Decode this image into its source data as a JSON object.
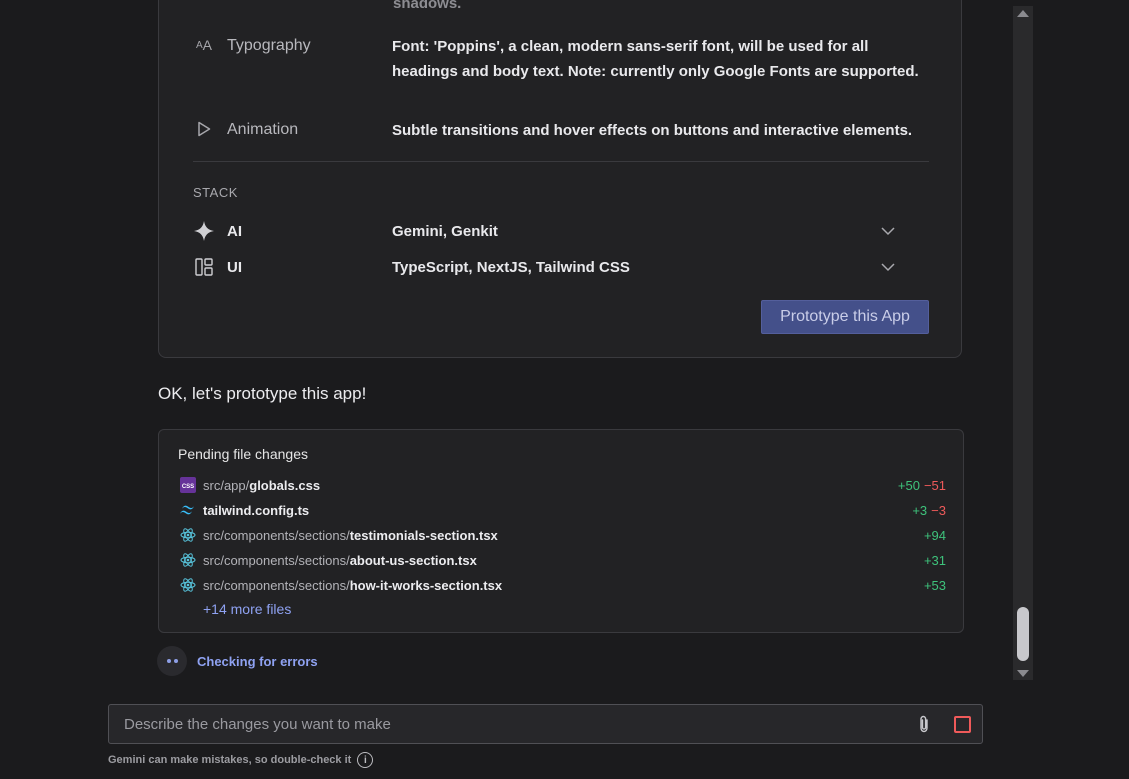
{
  "blueprint": {
    "clipped_text": "shadows.",
    "typography": {
      "label": "Typography",
      "value": "Font: 'Poppins', a clean, modern sans-serif font, will be used for all headings and body text. Note: currently only Google Fonts are supported."
    },
    "animation": {
      "label": "Animation",
      "value": "Subtle transitions and hover effects on buttons and interactive elements."
    },
    "stack_heading": "STACK",
    "stack": [
      {
        "label": "AI",
        "value": "Gemini, Genkit",
        "icon": "sparkle-icon"
      },
      {
        "label": "UI",
        "value": "TypeScript, NextJS, Tailwind CSS",
        "icon": "layout-icon"
      }
    ],
    "prototype_button": "Prototype this App"
  },
  "message": "OK, let's prototype this app!",
  "pending": {
    "title": "Pending file changes",
    "files": [
      {
        "dir": "src/app/",
        "name": "globals.css",
        "add": "+50",
        "del": "−51",
        "icon": "css-icon"
      },
      {
        "dir": "",
        "name": "tailwind.config.ts",
        "add": "+3",
        "del": "−3",
        "icon": "tailwind-icon"
      },
      {
        "dir": "src/components/sections/",
        "name": "testimonials-section.tsx",
        "add": "+94",
        "del": "",
        "icon": "react-icon"
      },
      {
        "dir": "src/components/sections/",
        "name": "about-us-section.tsx",
        "add": "+31",
        "del": "",
        "icon": "react-icon"
      },
      {
        "dir": "src/components/sections/",
        "name": "how-it-works-section.tsx",
        "add": "+53",
        "del": "",
        "icon": "react-icon"
      }
    ],
    "more": "+14 more files"
  },
  "status": "Checking for errors",
  "composer": {
    "placeholder": "Describe the changes you want to make"
  },
  "disclaimer": "Gemini can make mistakes, so double-check it",
  "colors": {
    "accent": "#8fa2f2",
    "add": "#3ec27b",
    "del": "#ef5a5a",
    "button": "#44508a"
  }
}
